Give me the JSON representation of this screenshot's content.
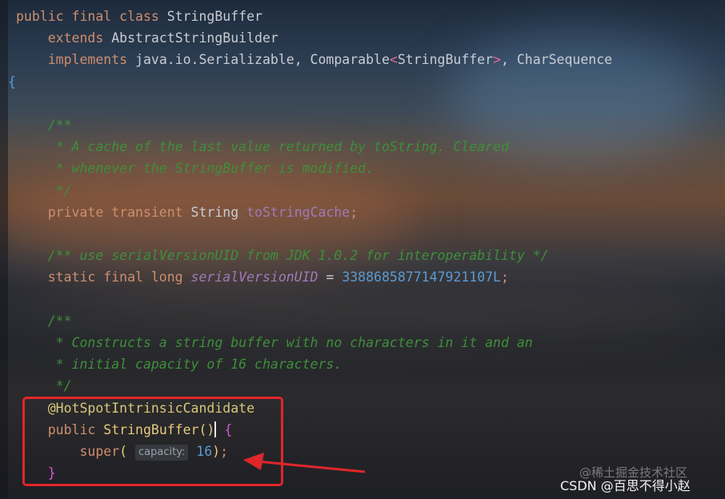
{
  "editor": {
    "lines": [
      {
        "tokens": [
          [
            "kw",
            "public final class "
          ],
          [
            "cls",
            "StringBuffer"
          ]
        ]
      },
      {
        "tokens": [
          [
            "kw",
            "    extends "
          ],
          [
            "cls",
            "AbstractStringBuilder"
          ]
        ]
      },
      {
        "tokens": [
          [
            "kw",
            "    implements "
          ],
          [
            "cls",
            "java.io.Serializable, Comparable"
          ],
          [
            "angle",
            "<"
          ],
          [
            "cls",
            "StringBuffer"
          ],
          [
            "angle",
            ">"
          ],
          [
            "cls",
            ", CharSequence"
          ]
        ]
      },
      {
        "tokens": [
          [
            "brace",
            "{"
          ]
        ]
      },
      {
        "tokens": []
      },
      {
        "tokens": [
          [
            "cm",
            "    /**"
          ]
        ]
      },
      {
        "tokens": [
          [
            "cm",
            "     * A cache of the last value returned by toString. Cleared"
          ]
        ]
      },
      {
        "tokens": [
          [
            "cm",
            "     * whenever the StringBuffer is modified."
          ]
        ]
      },
      {
        "tokens": [
          [
            "cm",
            "     */"
          ]
        ]
      },
      {
        "tokens": [
          [
            "kw",
            "    private transient "
          ],
          [
            "cls",
            "String "
          ],
          [
            "field",
            "toStringCache"
          ],
          [
            "kw",
            ";"
          ]
        ]
      },
      {
        "tokens": []
      },
      {
        "tokens": [
          [
            "cm",
            "    /** use serialVersionUID from JDK 1.0.2 for interoperability */"
          ]
        ]
      },
      {
        "tokens": [
          [
            "kw",
            "    static final long "
          ],
          [
            "field ital",
            "serialVersionUID"
          ],
          [
            "cls",
            " = "
          ],
          [
            "num",
            "3388685877147921107L"
          ],
          [
            "kw",
            ";"
          ]
        ]
      },
      {
        "tokens": []
      },
      {
        "tokens": [
          [
            "cm",
            "    /**"
          ]
        ]
      },
      {
        "tokens": [
          [
            "cm",
            "     * Constructs a string buffer with no characters in it and an"
          ]
        ]
      },
      {
        "tokens": [
          [
            "cm",
            "     * initial capacity of 16 characters."
          ]
        ]
      },
      {
        "tokens": [
          [
            "cm",
            "     */"
          ]
        ]
      },
      {
        "tokens": [
          [
            "ann",
            "    @HotSpotIntrinsicCandidate"
          ]
        ]
      },
      {
        "tokens": [
          [
            "kw",
            "    public "
          ],
          [
            "method",
            "StringBuffer"
          ],
          [
            "paren",
            "()"
          ],
          [
            "caret",
            ""
          ],
          [
            "cls",
            " "
          ],
          [
            "brace2",
            "{"
          ]
        ]
      },
      {
        "tokens": [
          [
            "kw",
            "        super"
          ],
          [
            "paren",
            "( "
          ],
          [
            "hint",
            "capacity:"
          ],
          [
            "num",
            " 16"
          ],
          [
            "paren",
            ")"
          ],
          [
            "kw",
            ";"
          ]
        ]
      },
      {
        "tokens": [
          [
            "brace2",
            "    }"
          ]
        ]
      }
    ]
  },
  "watermark": {
    "juejin": "@稀土掘金技术社区",
    "csdn": "CSDN @百思不得小赵"
  },
  "colors": {
    "annotation_box": "#e0262b",
    "arrow": "#e0262b"
  }
}
